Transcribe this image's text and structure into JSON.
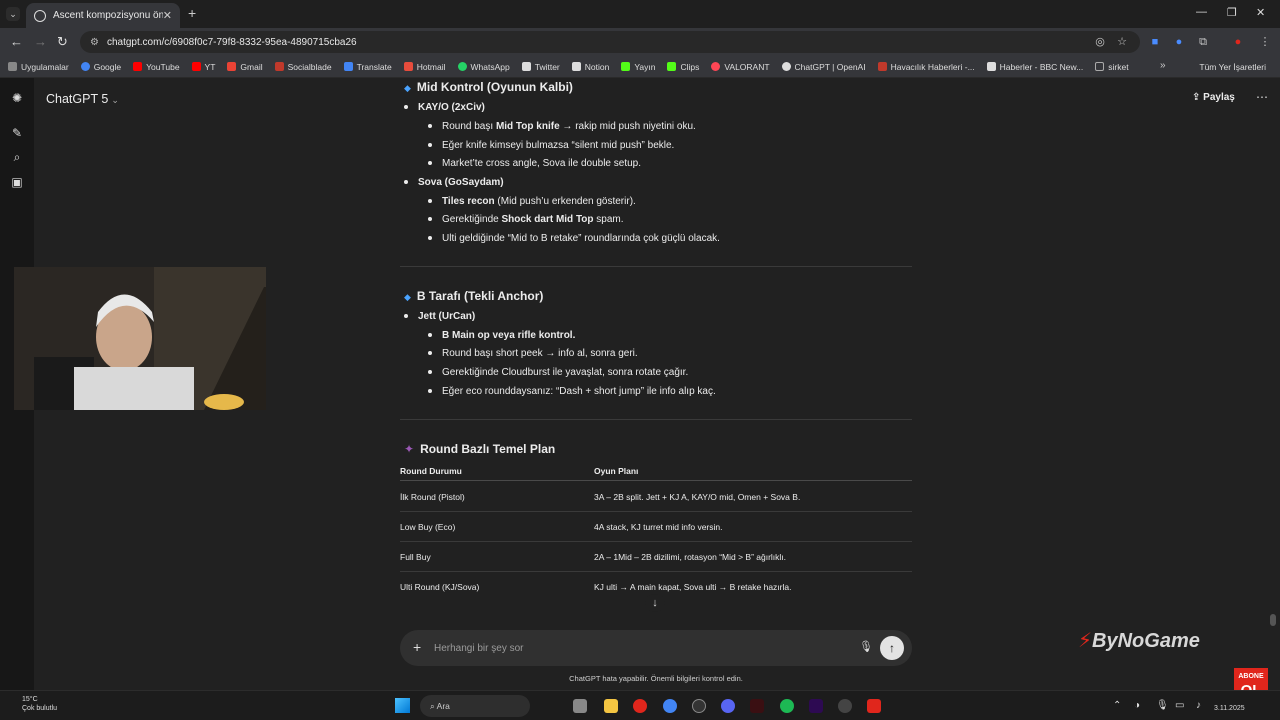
{
  "browser": {
    "tab_title": "Ascent kompozisyonu önerisi",
    "url": "chatgpt.com/c/6908f0c7-79f8-8332-95ea-4890715cba26",
    "bookmarks": [
      {
        "label": "Uygulamalar",
        "color": "#888888"
      },
      {
        "label": "Google",
        "color": "#4285f4"
      },
      {
        "label": "YouTube",
        "color": "#ff0000"
      },
      {
        "label": "YT",
        "color": "#ff0000"
      },
      {
        "label": "Gmail",
        "color": "#ea4335"
      },
      {
        "label": "Socialblade",
        "color": "#c0392b"
      },
      {
        "label": "Translate",
        "color": "#4285f4"
      },
      {
        "label": "Hotmail",
        "color": "#e74c3c"
      },
      {
        "label": "WhatsApp",
        "color": "#25d366"
      },
      {
        "label": "Twitter",
        "color": "#dddddd"
      },
      {
        "label": "Notion",
        "color": "#dddddd"
      },
      {
        "label": "Yayın",
        "color": "#53fc18"
      },
      {
        "label": "Clips",
        "color": "#53fc18"
      },
      {
        "label": "VALORANT",
        "color": "#ff4655"
      },
      {
        "label": "ChatGPT | OpenAI",
        "color": "#dddddd"
      },
      {
        "label": "Havacılık Haberleri -...",
        "color": "#c0392b"
      },
      {
        "label": "Haberler - BBC New...",
        "color": "#dddddd"
      },
      {
        "label": "sirket",
        "color": "#aaaaaa"
      }
    ],
    "all_bookmarks": "Tüm Yer İşaretleri"
  },
  "app": {
    "model": "ChatGPT 5",
    "share": "Paylaş"
  },
  "message": {
    "mid_heading": "Mid Kontrol (Oyunun Kalbi)",
    "kayo_label": "KAY/O (2xCiv)",
    "kayo_1_pre": "Round başı ",
    "kayo_1_bold": "Mid Top knife",
    "kayo_1_post": " → rakip mid push niyetini oku.",
    "kayo_2": "Eğer knife kimseyi bulmazsa “silent mid push” bekle.",
    "kayo_3": "Market’te cross angle, Sova ile double setup.",
    "sova_label": "Sova (GoSaydam)",
    "sova_1_bold": "Tiles recon",
    "sova_1_post": " (Mid push’u erkenden gösterir).",
    "sova_2_pre": "Gerektiğinde ",
    "sova_2_bold": "Shock dart Mid Top",
    "sova_2_post": " spam.",
    "sova_3": "Ulti geldiğinde “Mid to B retake” roundlarında çok güçlü olacak.",
    "b_heading": "B Tarafı (Tekli Anchor)",
    "jett_label": "Jett (UrCan)",
    "jett_1": "B Main op veya rifle kontrol.",
    "jett_2": "Round başı short peek → info al, sonra geri.",
    "jett_3": "Gerektiğinde Cloudburst ile yavaşlat, sonra rotate çağır.",
    "jett_4": "Eğer eco rounddaysanız: “Dash + short jump” ile info alıp kaç.",
    "plan_heading": "Round Bazlı Temel Plan",
    "table": {
      "headers": [
        "Round Durumu",
        "Oyun Planı"
      ],
      "rows": [
        [
          "İlk Round (Pistol)",
          "3A – 2B split. Jett + KJ A, KAY/O mid, Omen + Sova B."
        ],
        [
          "Low Buy (Eco)",
          "4A stack, KJ turret mid info versin."
        ],
        [
          "Full Buy",
          "2A – 1Mid – 2B dizilimi, rotasyon “Mid > B” ağırlıklı."
        ],
        [
          "Ulti Round (KJ/Sova)",
          "KJ ulti → A main kapat, Sova ulti → B retake hazırla."
        ]
      ]
    }
  },
  "composer": {
    "placeholder": "Herhangi bir şey sor",
    "disclaimer": "ChatGPT hata yapabilir. Önemli bilgileri kontrol edin."
  },
  "overlay": {
    "logo": "ByNoGame",
    "abone_top": "ABONE",
    "abone_bottom": "OL"
  },
  "taskbar": {
    "temp": "15°C",
    "weather": "Çok bulutlu",
    "search": "Ara",
    "date": "3.11.2025"
  }
}
